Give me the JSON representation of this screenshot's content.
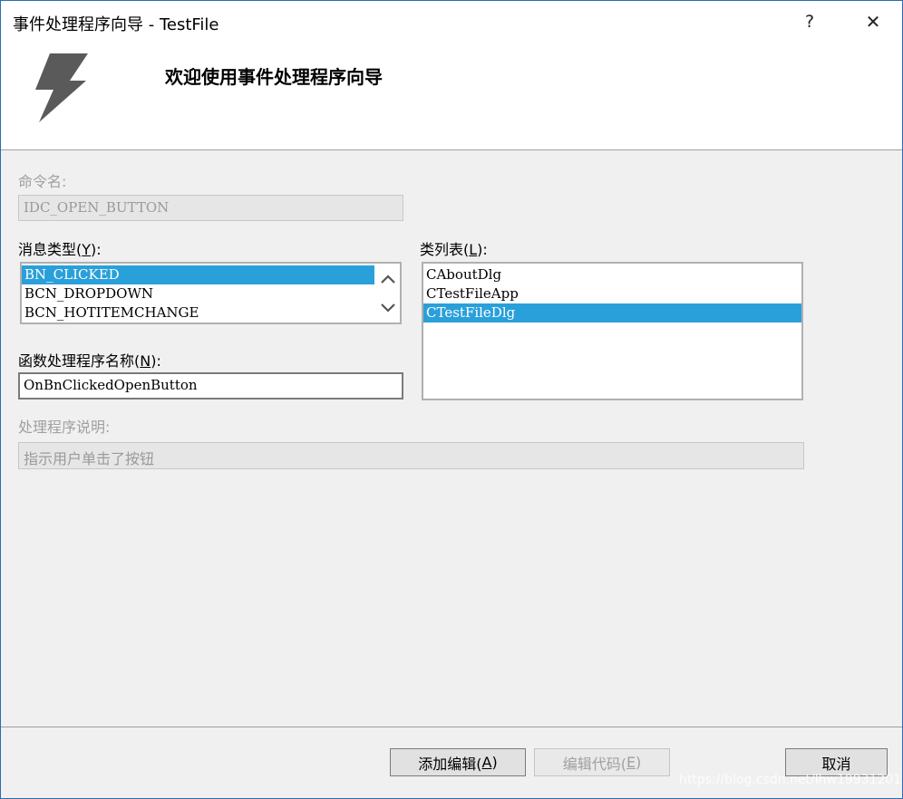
{
  "window": {
    "title": "事件处理程序向导 - TestFile",
    "help_glyph": "?",
    "close_glyph": "✕"
  },
  "header": {
    "title": "欢迎使用事件处理程序向导",
    "icon": "lightning-bolt-icon"
  },
  "command": {
    "label": "命令名:",
    "value": "IDC_OPEN_BUTTON"
  },
  "message_type": {
    "label_prefix": "消息类型(",
    "label_key": "Y",
    "label_suffix": "):",
    "items": [
      "BN_CLICKED",
      "BCN_DROPDOWN",
      "BCN_HOTITEMCHANGE"
    ],
    "selected_index": 0
  },
  "class_list": {
    "label_prefix": "类列表(",
    "label_key": "L",
    "label_suffix": "):",
    "items": [
      "CAboutDlg",
      "CTestFileApp",
      "CTestFileDlg"
    ],
    "selected_index": 2
  },
  "handler_name": {
    "label_prefix": "函数处理程序名称(",
    "label_key": "N",
    "label_suffix": "):",
    "value": "OnBnClickedOpenButton"
  },
  "handler_description": {
    "label": "处理程序说明:",
    "value": "指示用户单击了按钮"
  },
  "buttons": {
    "add_edit": {
      "prefix": "添加编辑(",
      "key": "A",
      "suffix": ")"
    },
    "edit_code": {
      "prefix": "编辑代码(",
      "key": "E",
      "suffix": ")"
    },
    "cancel": "取消"
  },
  "watermark": "https://blog.csdn.net/lhw19931201",
  "colors": {
    "selection": "#2aa0da",
    "disabled_text": "#a0a0a0",
    "bolt": "#5a5a5a"
  }
}
